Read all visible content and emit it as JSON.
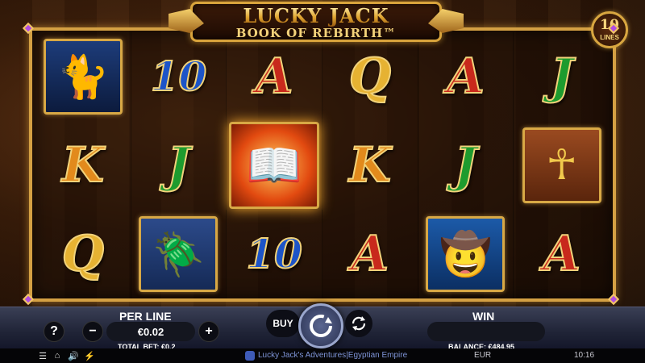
{
  "game": {
    "title": "LUCKY JACK",
    "subtitle": "BOOK OF REBIRTH™"
  },
  "lines_badge": {
    "count": "10",
    "label": "LINES"
  },
  "reels": {
    "rows": [
      [
        {
          "kind": "tile",
          "symbol": "cat-icon",
          "variant": "tile-cat",
          "glyph": "🐈"
        },
        {
          "kind": "letter",
          "symbol": "10",
          "color": "c-blue",
          "ten": true
        },
        {
          "kind": "letter",
          "symbol": "A",
          "color": "c-red"
        },
        {
          "kind": "letter",
          "symbol": "Q",
          "color": "c-gold"
        },
        {
          "kind": "letter",
          "symbol": "A",
          "color": "c-red"
        },
        {
          "kind": "letter",
          "symbol": "J",
          "color": "c-green"
        }
      ],
      [
        {
          "kind": "letter",
          "symbol": "K",
          "color": "c-orange"
        },
        {
          "kind": "letter",
          "symbol": "J",
          "color": "c-green"
        },
        {
          "kind": "tile",
          "symbol": "book-icon",
          "variant": "tile-book",
          "glyph": "📖"
        },
        {
          "kind": "letter",
          "symbol": "K",
          "color": "c-orange"
        },
        {
          "kind": "letter",
          "symbol": "J",
          "color": "c-green"
        },
        {
          "kind": "tile",
          "symbol": "ankh-icon",
          "variant": "tile-ankh",
          "glyph": "☥"
        }
      ],
      [
        {
          "kind": "letter",
          "symbol": "Q",
          "color": "c-gold"
        },
        {
          "kind": "tile",
          "symbol": "scarab-icon",
          "variant": "tile-scarab",
          "glyph": "🪲"
        },
        {
          "kind": "letter",
          "symbol": "10",
          "color": "c-blue",
          "ten": true
        },
        {
          "kind": "letter",
          "symbol": "A",
          "color": "c-red"
        },
        {
          "kind": "tile",
          "symbol": "explorer-icon",
          "variant": "tile-jack",
          "glyph": "🤠"
        },
        {
          "kind": "letter",
          "symbol": "A",
          "color": "c-red"
        }
      ]
    ]
  },
  "controls": {
    "help_label": "?",
    "per_line_label": "PER LINE",
    "per_line_value": "€0.02",
    "minus_label": "−",
    "plus_label": "+",
    "total_bet": "TOTAL BET: €0.2",
    "buy_label": "BUY",
    "win_label": "WIN",
    "win_value": "",
    "balance": "BALANCE: €484.95"
  },
  "footer": {
    "game_name": "Lucky Jack's Adventures|Egyptian Empire",
    "currency": "EUR",
    "clock": "10:16"
  },
  "colors": {
    "frame_gold": "#d4a043",
    "bar_dark": "#202437",
    "accent_blue": "#7f95d8"
  }
}
